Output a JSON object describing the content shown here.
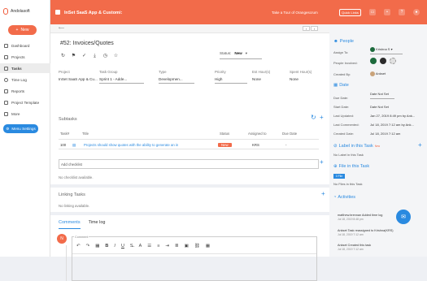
{
  "brand": {
    "name": "Andolasoft"
  },
  "sidebar": {
    "new_label": "New",
    "items": [
      {
        "label": "Dashboard"
      },
      {
        "label": "Projects"
      },
      {
        "label": "Tasks"
      },
      {
        "label": "Time Log"
      },
      {
        "label": "Reports"
      },
      {
        "label": "Project Template"
      },
      {
        "label": "More"
      }
    ],
    "menu_settings": "Menu Settings"
  },
  "topbar": {
    "project": "InSet SaaS App & Customi:",
    "tour": "Take a Tour of Orangescrum",
    "quick_links": "Quick Links"
  },
  "task": {
    "title": "#52: Invoices/Quotes",
    "status_label": "Status:",
    "status_value": "New",
    "fields": {
      "project_label": "Project",
      "project_value": "InSet SaaS App & Cu...",
      "taskgroup_label": "Task Group",
      "taskgroup_value": "Sprint 1 - Adde...",
      "type_label": "Type",
      "type_value": "Developmen...",
      "priority_label": "Priority",
      "priority_value": "High",
      "esthour_label": "Est Hour(s)",
      "esthour_value": "None",
      "spenthour_label": "Spent Hour(s)",
      "spenthour_value": "None"
    }
  },
  "subtasks": {
    "title": "Subtasks",
    "headers": {
      "task": "Task#",
      "title": "Title",
      "status": "Status",
      "assigned": "Assigned to",
      "due": "Due Date"
    },
    "rows": [
      {
        "task": "100",
        "title": "Projects should show quotes with the ability to generate an in",
        "status": "New",
        "assigned": "KRS",
        "due": "-"
      }
    ]
  },
  "checklist": {
    "placeholder": "Add checklist",
    "empty": "No checklist available."
  },
  "linking": {
    "title": "Linking Tasks",
    "empty": "No linking available."
  },
  "comments": {
    "tab_comments": "Comments",
    "tab_timelog": "Time log",
    "avatar": "N",
    "editor_label": "Comment"
  },
  "right": {
    "people_title": "People",
    "assign_to_label": "Assign To:",
    "assign_to_value": "Krishna S",
    "people_involved_label": "People Involved:",
    "created_by_label": "Created By:",
    "created_by_value": "Ankset",
    "date_title": "Date",
    "due_date_label": "Due Date:",
    "due_date_value": "Date Not Set",
    "start_date_label": "Start Date:",
    "start_date_value": "Date Not Set",
    "last_updated_label": "Last Updated:",
    "last_updated_value": "Jan 27, 2019 8:49 pm by Ank...",
    "last_commented_label": "Last Commented:",
    "last_commented_value": "Jul 18, 2019 7:12 am by Ank...",
    "created_date_label": "Created Date:",
    "created_date_value": "Jul 18, 2019 7:12 am",
    "label_title": "Label in this Task",
    "label_new": "New",
    "label_empty": "No Label in this Task",
    "file_title": "File in this Task",
    "file_flag": "0 File",
    "file_empty": "No Files in this Task",
    "activities_title": "Activities",
    "activities": [
      {
        "text": "matthew.brennan Added time log",
        "time": "Jul 18, 2019 8:48 pm"
      },
      {
        "text": "Ankset Task reassigned to Krishna(KRS)",
        "time": "Jul 18, 2019 7:12 am"
      },
      {
        "text": "Ankset Created this task",
        "time": "Jul 18, 2019 7:12 am"
      }
    ]
  }
}
